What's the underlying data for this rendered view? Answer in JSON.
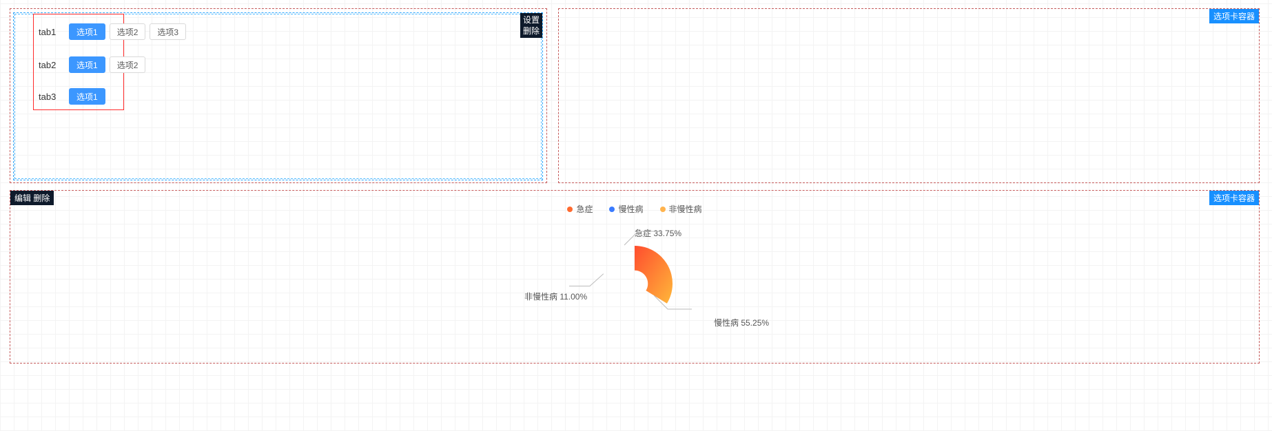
{
  "containers": {
    "tc1_label": "",
    "tc2_label": "选项卡容器",
    "tc3_label": "选项卡容器"
  },
  "selectbox": {
    "action_settings": "设置",
    "action_delete": "删除"
  },
  "tabs": {
    "g1_name": "tab1",
    "g1_opts": [
      "选项1",
      "选项2",
      "选项3"
    ],
    "g2_name": "tab2",
    "g2_opts": [
      "选项1",
      "选项2"
    ],
    "g3_name": "tab3",
    "g3_opts": [
      "选项1"
    ]
  },
  "bottom": {
    "edit": "编辑",
    "delete": "删除"
  },
  "legend": {
    "s1": "急症",
    "s2": "慢性病",
    "s3": "非慢性病"
  },
  "colors": {
    "s1_dot": "#ff6a2f",
    "s2_dot": "#3a7bff",
    "s3_dot": "#ffb34d"
  },
  "chart_labels": {
    "l1": "急症 33.75%",
    "l2": "慢性病 55.25%",
    "l3": "非慢性病 11.00%"
  },
  "chart_data": {
    "type": "pie",
    "title": "",
    "series": [
      {
        "name": "急症",
        "value": 33.75,
        "color_start": "#ff4d2e",
        "color_end": "#ffb73a"
      },
      {
        "name": "慢性病",
        "value": 55.25,
        "color_start": "#2f9bff",
        "color_end": "#8b3dff"
      },
      {
        "name": "非慢性病",
        "value": 11.0,
        "color_start": "#ffd23a",
        "color_end": "#ff8a3a"
      }
    ],
    "donut_inner_ratio": 0.35
  }
}
